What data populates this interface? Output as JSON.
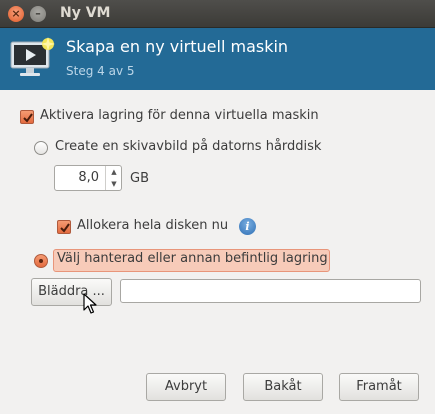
{
  "window": {
    "title": "Ny VM"
  },
  "header": {
    "title": "Skapa en ny virtuell maskin",
    "subtitle": "Steg 4 av 5",
    "icon": "monitor-icon"
  },
  "storage": {
    "enable_label": "Aktivera lagring för denna virtuella maskin",
    "enable_checked": true,
    "create_image_label": "Create en skivavbild på datorns hårddisk",
    "size_value": "8,0",
    "size_unit": "GB",
    "allocate_label": "Allokera hela disken nu",
    "allocate_checked": true,
    "managed_label": "Välj hanterad eller annan befintlig lagring",
    "managed_selected": true,
    "browse_label": "Bläddra ...",
    "path_value": ""
  },
  "footer": {
    "cancel_label": "Avbryt",
    "back_label": "Bakåt",
    "forward_label": "Framåt"
  },
  "colors": {
    "banner": "#236a96",
    "accent": "#e46b3f",
    "titlebar": "#3c3b37"
  }
}
